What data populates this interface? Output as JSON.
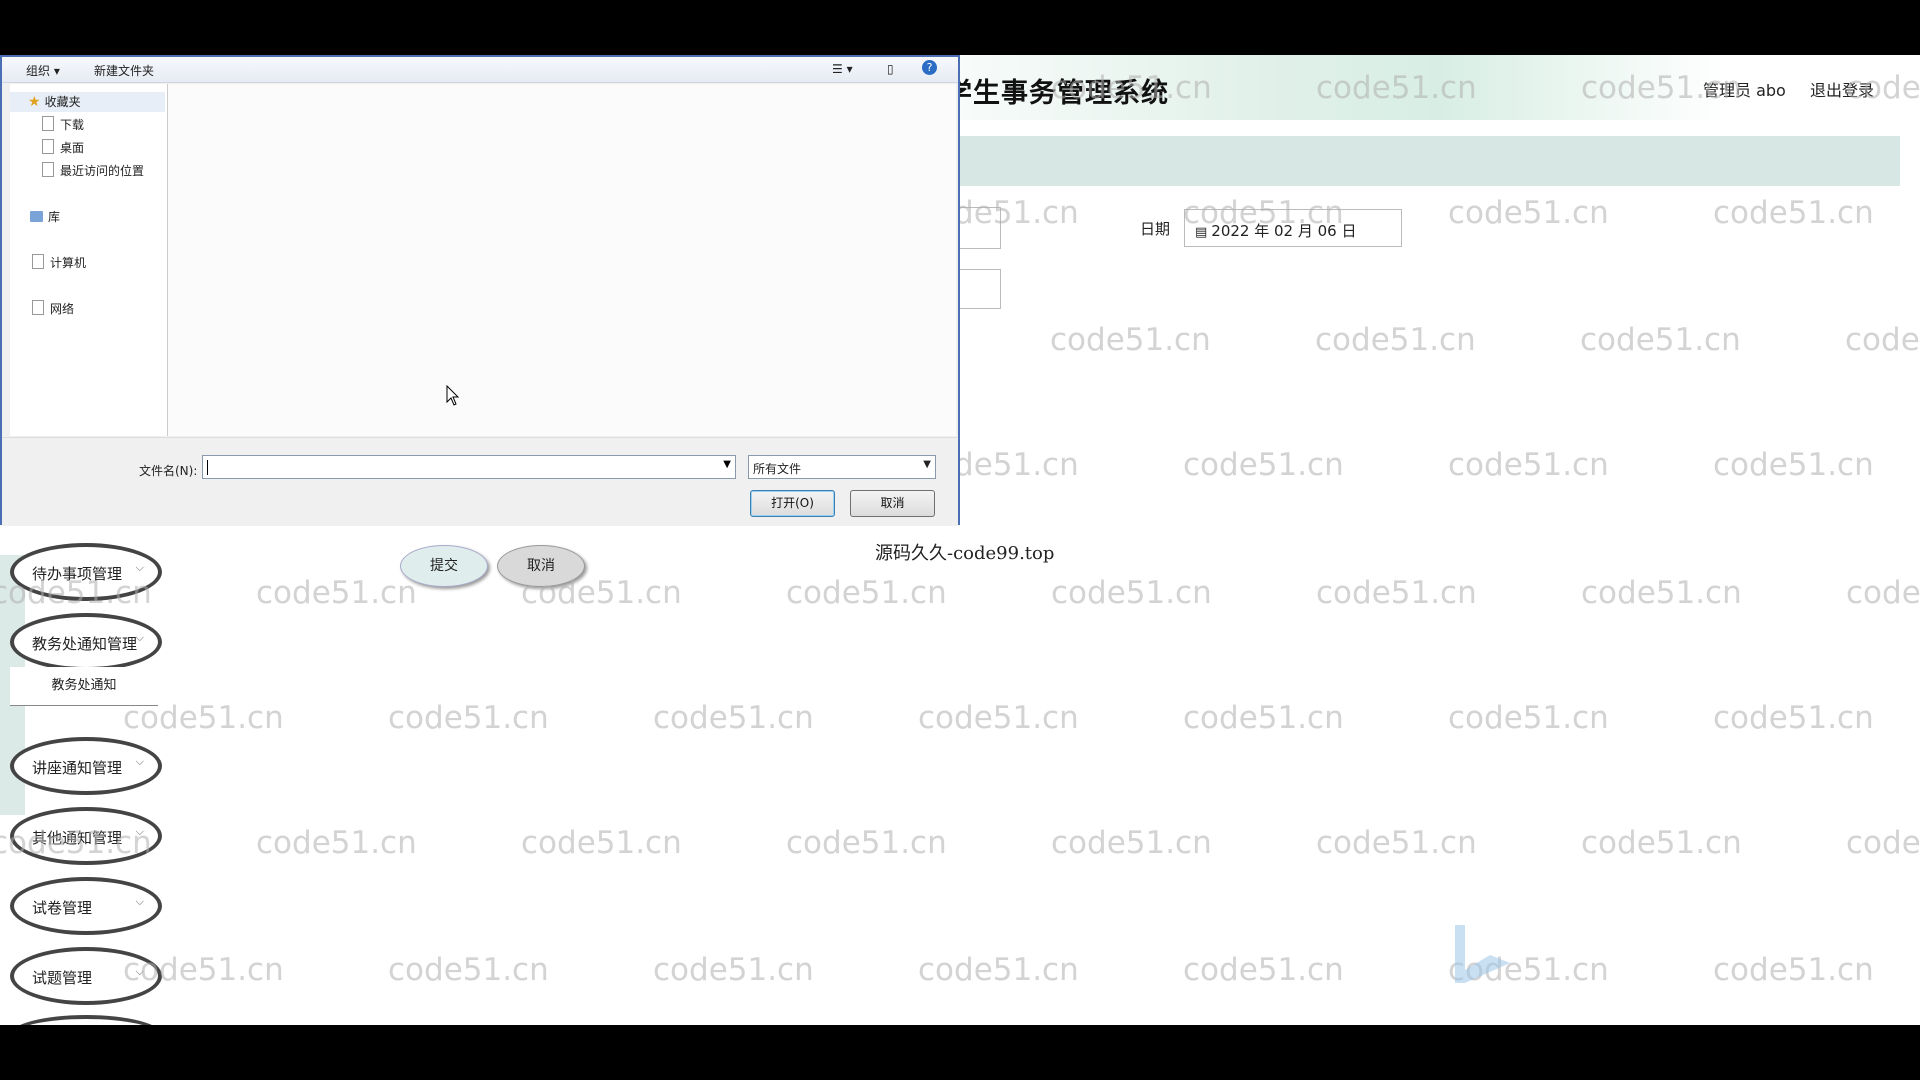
{
  "header": {
    "title": "学生事务管理系统",
    "admin_label": "管理员 abo",
    "logout_label": "退出登录"
  },
  "form": {
    "date_label": "日期",
    "date_value": "2022 年 02 月 06 日",
    "submit_label": "提交",
    "cancel_label": "取消"
  },
  "overlay_text": "源码久久-code99.top",
  "watermark": "code51.cn",
  "sidebar": {
    "items": [
      {
        "label": "待办事项管理"
      },
      {
        "label": "教务处通知管理"
      },
      {
        "label": "讲座通知管理"
      },
      {
        "label": "其他通知管理"
      },
      {
        "label": "试卷管理"
      },
      {
        "label": "试题管理"
      }
    ],
    "sub_item": "教务处通知"
  },
  "dialog": {
    "toolbar": {
      "organize": "组织 ▾",
      "new_folder": "新建文件夹"
    },
    "nav": {
      "favorites": "收藏夹",
      "downloads": "下载",
      "desktop": "桌面",
      "recent": "最近访问的位置",
      "libraries": "库",
      "computer": "计算机",
      "network": "网络"
    },
    "filename_label": "文件名(N):",
    "filename_value": "",
    "filetype_value": "所有文件",
    "open_label": "打开(O)",
    "cancel_label": "取消"
  }
}
